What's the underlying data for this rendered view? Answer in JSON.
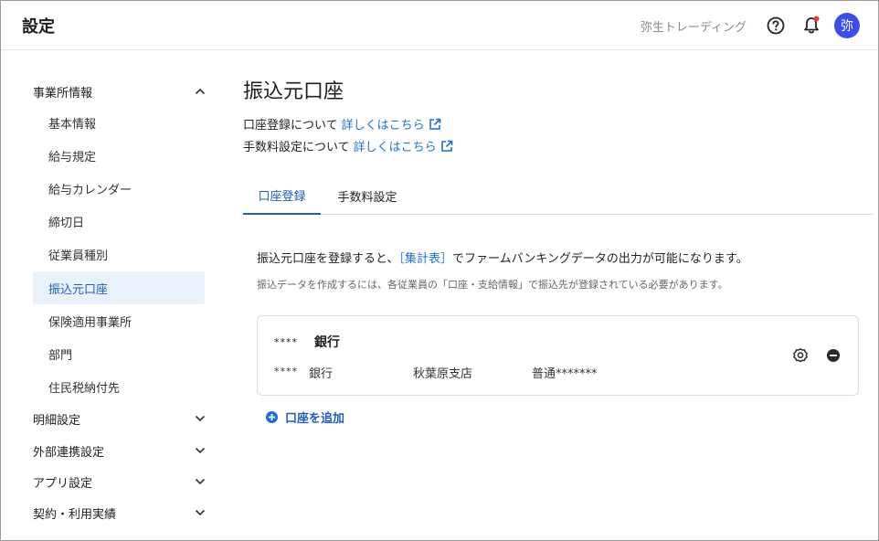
{
  "header": {
    "title": "設定",
    "company": "弥生トレーディング",
    "avatar_text": "弥"
  },
  "sidebar": {
    "groups": [
      {
        "label": "事業所情報",
        "expanded": true,
        "items": [
          "基本情報",
          "給与規定",
          "給与カレンダー",
          "締切日",
          "従業員種別",
          "振込元口座",
          "保険適用事業所",
          "部門",
          "住民税納付先"
        ],
        "active_item": "振込元口座"
      },
      {
        "label": "明細設定",
        "expanded": false
      },
      {
        "label": "外部連携設定",
        "expanded": false
      },
      {
        "label": "アプリ設定",
        "expanded": false
      },
      {
        "label": "契約・利用実績",
        "expanded": false
      }
    ]
  },
  "main": {
    "title": "振込元口座",
    "info": [
      {
        "text": "口座登録について",
        "link": "詳しくはこちら"
      },
      {
        "text": "手数料設定について",
        "link": "詳しくはこちら"
      }
    ],
    "tabs": [
      {
        "label": "口座登録",
        "active": true
      },
      {
        "label": "手数料設定",
        "active": false
      }
    ],
    "description_before": "振込元口座を登録すると、",
    "description_link": "［集計表］",
    "description_after": "でファームバンキングデータの出力が可能になります。",
    "note": "振込データを作成するには、各従業員の「口座・支給情報」で振込先が登録されている必要があります。",
    "account": {
      "bank_mask": "****",
      "bank_label": "銀行",
      "detail_mask": "****",
      "detail_bank": "銀行",
      "branch": "秋葉原支店",
      "type_and_number": "普通*******"
    },
    "add_button": "口座を追加"
  },
  "colors": {
    "accent": "#1f5fb5",
    "link": "#1f6fd1",
    "avatar_bg": "#3c4ee8",
    "notification_dot": "#e53935",
    "active_bg": "#e9f1fb"
  }
}
